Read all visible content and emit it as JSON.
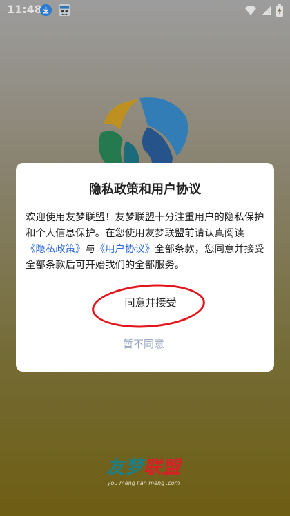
{
  "status_bar": {
    "time": "11:48"
  },
  "dialog": {
    "title": "隐私政策和用户协议",
    "body_part1": "欢迎使用友梦联盟！友梦联盟十分注重用户的隐私保护和个人信息保护。在您使用友梦联盟前请认真阅读 ",
    "privacy_link": "《隐私政策》",
    "body_part2": "与",
    "agreement_link": "《用户协议》",
    "body_part3": "全部条款，您同意并接受全部条款后可开始我们的全部服务。",
    "agree_label": "同意并接受",
    "disagree_label": "暂不同意"
  },
  "brand": {
    "name_part1": "友梦",
    "name_part2": "联盟",
    "url": "you meng lian meng .com"
  },
  "colors": {
    "link": "#2d6bd6",
    "disagree": "#9aa7bf",
    "highlight_circle": "#e3141a",
    "brand_teal": "#1a7f86",
    "brand_red": "#d62224"
  }
}
